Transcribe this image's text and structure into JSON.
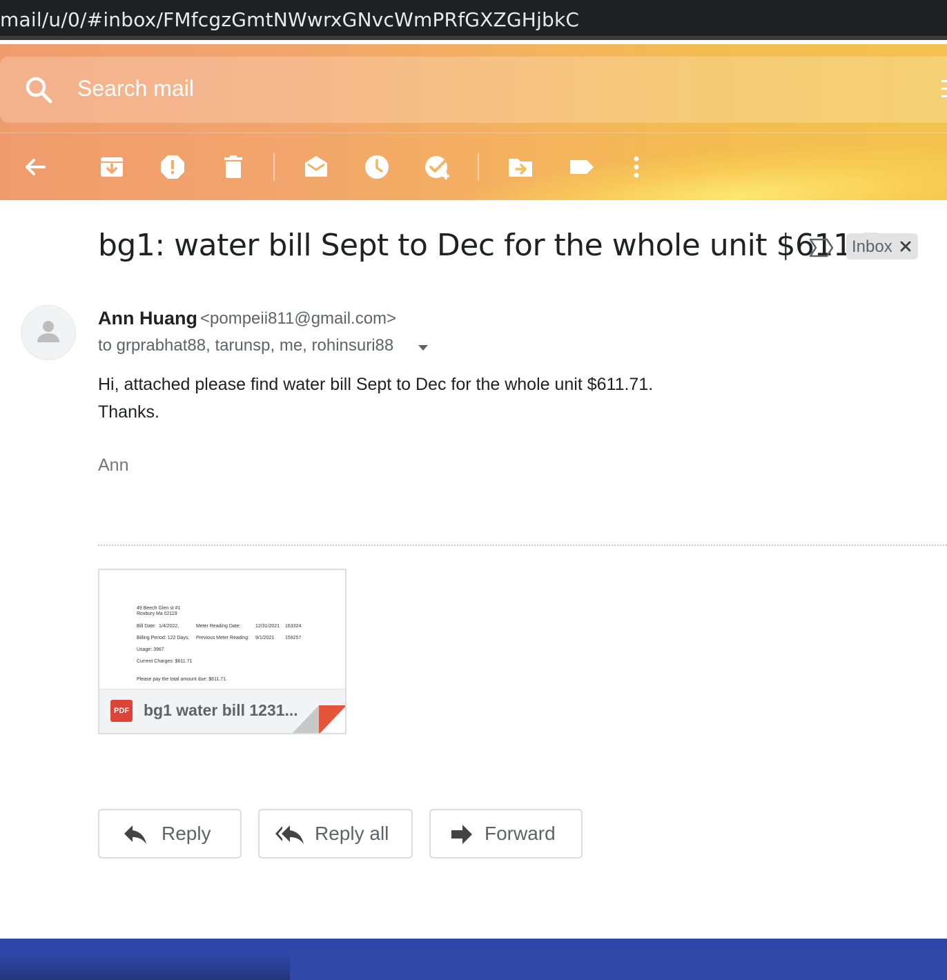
{
  "browser": {
    "url": "mail/u/0/#inbox/FMfcgzGmtNWwrxGNvcWmPRfGXZGHjbkC"
  },
  "search": {
    "placeholder": "Search mail"
  },
  "toolbar": {
    "icons": [
      "back-arrow-icon",
      "archive-icon",
      "report-spam-icon",
      "delete-icon",
      "mark-unread-icon",
      "snooze-icon",
      "add-to-tasks-icon",
      "move-to-icon",
      "labels-icon",
      "more-options-icon"
    ]
  },
  "email": {
    "subject": "bg1: water bill Sept to Dec for the whole unit $611.71",
    "label_chip": "Inbox",
    "sender_name": "Ann Huang",
    "sender_email": "<pompeii811@gmail.com>",
    "recipients": "to grprabhat88, tarunsp, me, rohinsuri88",
    "body_lines": [
      "Hi, attached please find water bill Sept to Dec for the whole unit $611.71.",
      "Thanks."
    ],
    "signature": "Ann"
  },
  "attachment": {
    "type_badge": "PDF",
    "filename": "bg1 water bill 1231...",
    "preview": {
      "address_1": "49 Beech Glen st #1",
      "address_2": "Roxbury Ma 02119",
      "bill_date_label": "Bill Date:",
      "bill_date": "1/4/2022,",
      "meter_reading_label": "Meter Reading Date:",
      "meter_reading_date": "12/31/2021",
      "meter_reading_value": "163324",
      "billing_period": "Billing Period: 122 Days,",
      "prev_meter_label": "Previous Meter Reading:",
      "prev_meter_date": "9/1/2021",
      "prev_meter_value": "159257",
      "usage": "Usage: 3967",
      "current_charges": "Current Charges: $611.71",
      "total_due": "Please pay the total amount due: $611.71."
    }
  },
  "actions": {
    "reply": "Reply",
    "reply_all": "Reply all",
    "forward": "Forward"
  },
  "colors": {
    "header_start": "#f09b6c",
    "header_end": "#f3c34e",
    "pdf_red": "#db4437",
    "bottom_bar": "#2e46a8"
  }
}
